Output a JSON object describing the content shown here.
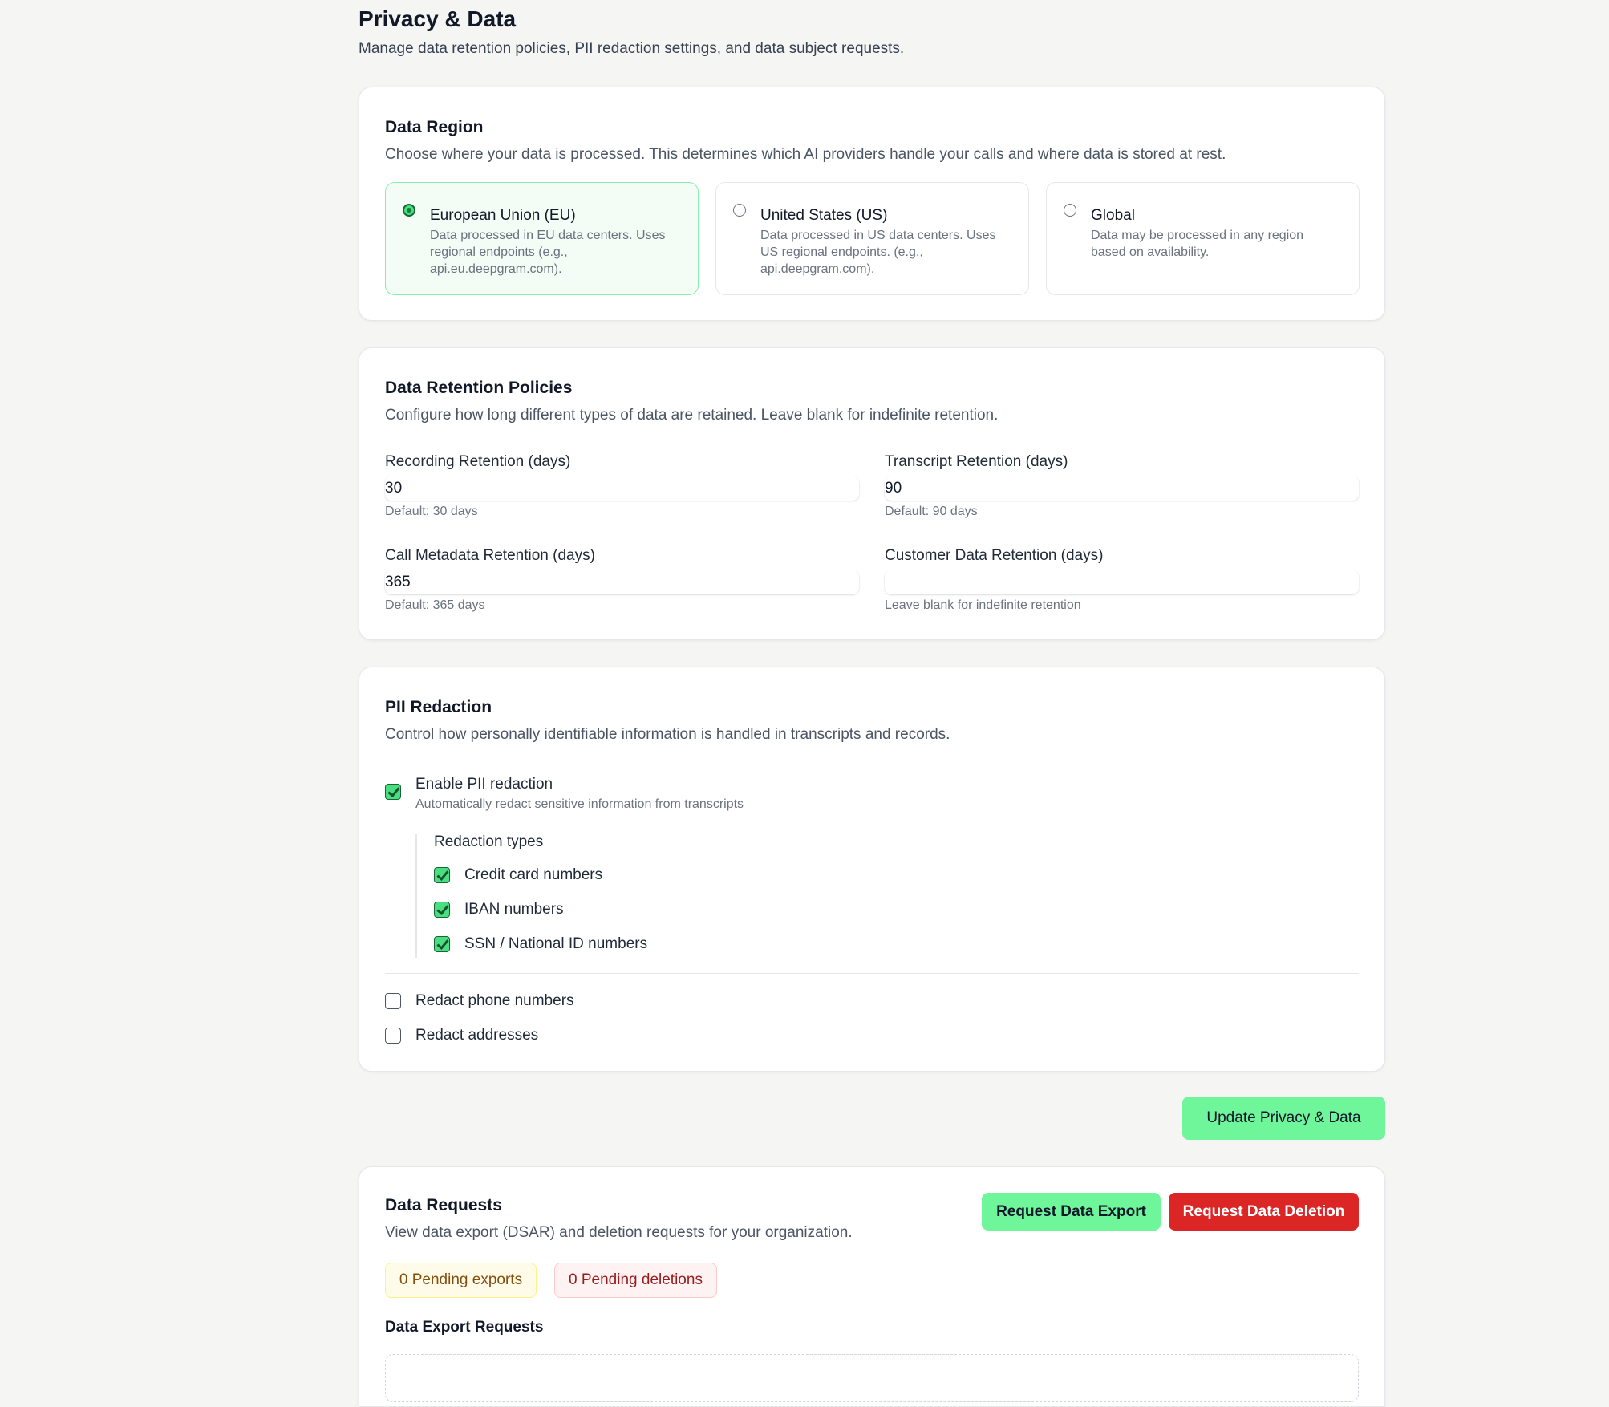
{
  "page": {
    "title": "Privacy & Data",
    "subtitle": "Manage data retention policies, PII redaction settings, and data subject requests."
  },
  "region": {
    "title": "Data Region",
    "description": "Choose where your data is processed. This determines which AI providers handle your calls and where data is stored at rest.",
    "selected": "eu",
    "options": [
      {
        "id": "eu",
        "name": "European Union (EU)",
        "description": "Data processed in EU data centers. Uses regional endpoints (e.g., api.eu.deepgram.com)."
      },
      {
        "id": "us",
        "name": "United States (US)",
        "description": "Data processed in US data centers. Uses US regional endpoints. (e.g., api.deepgram.com)."
      },
      {
        "id": "global",
        "name": "Global",
        "description": "Data may be processed in any region based on availability."
      }
    ]
  },
  "retention": {
    "title": "Data Retention Policies",
    "description": "Configure how long different types of data are retained. Leave blank for indefinite retention.",
    "fields": [
      {
        "label": "Recording Retention (days)",
        "value": "30",
        "help": "Default: 30 days"
      },
      {
        "label": "Transcript Retention (days)",
        "value": "90",
        "help": "Default: 90 days"
      },
      {
        "label": "Call Metadata Retention (days)",
        "value": "365",
        "help": "Default: 365 days"
      },
      {
        "label": "Customer Data Retention (days)",
        "value": "",
        "help": "Leave blank for indefinite retention"
      }
    ]
  },
  "pii": {
    "title": "PII Redaction",
    "description": "Control how personally identifiable information is handled in transcripts and records.",
    "enable": {
      "label": "Enable PII redaction",
      "sublabel": "Automatically redact sensitive information from transcripts",
      "checked": true
    },
    "types_label": "Redaction types",
    "types": [
      {
        "label": "Credit card numbers",
        "checked": true
      },
      {
        "label": "IBAN numbers",
        "checked": true
      },
      {
        "label": "SSN / National ID numbers",
        "checked": true
      }
    ],
    "extra": [
      {
        "label": "Redact phone numbers",
        "checked": false
      },
      {
        "label": "Redact addresses",
        "checked": false
      }
    ]
  },
  "update_button": "Update Privacy & Data",
  "requests": {
    "title": "Data Requests",
    "description": "View data export (DSAR) and deletion requests for your organization.",
    "export_button": "Request Data Export",
    "delete_button": "Request Data Deletion",
    "pending_exports": "0 Pending exports",
    "pending_deletions": "0 Pending deletions",
    "export_requests_title": "Data Export Requests"
  },
  "colors": {
    "accent_green": "#6ff59a",
    "danger_red": "#dc2626",
    "selected_border": "#86efac"
  }
}
